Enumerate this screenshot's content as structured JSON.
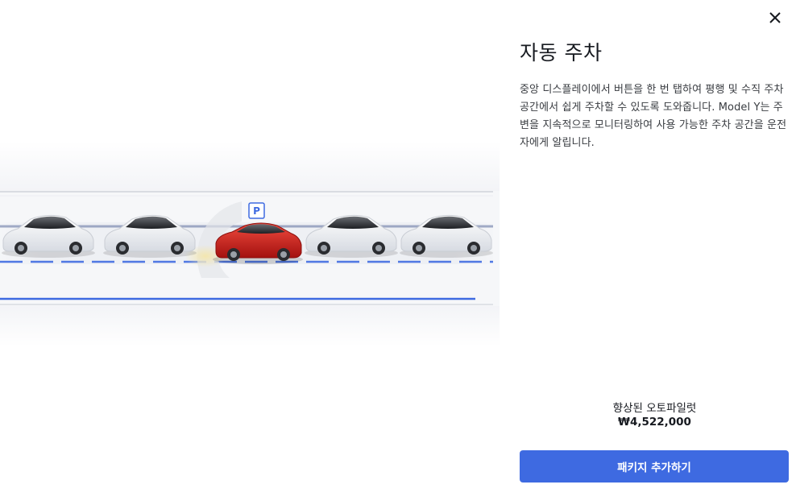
{
  "modal": {
    "close_icon": "close-icon"
  },
  "feature": {
    "title": "자동 주차",
    "description": "중앙 디스플레이에서 버튼을 한 번 탭하여 평행 및 수직 주차 공간에서 쉽게 주차할 수 있도록 도와줍니다. Model Y는 주변을 지속적으로 모니터링하여 사용 가능한 주차 공간을 운전자에게 알립니다."
  },
  "illustration": {
    "parking_sign": "P",
    "highlight_car_color": "#d21f1c",
    "lane_line_color": "#3e6ae1"
  },
  "package": {
    "name": "향상된 오토파일럿",
    "price": "₩4,522,000",
    "add_button_label": "패키지 추가하기",
    "button_color": "#3e6ae1"
  }
}
